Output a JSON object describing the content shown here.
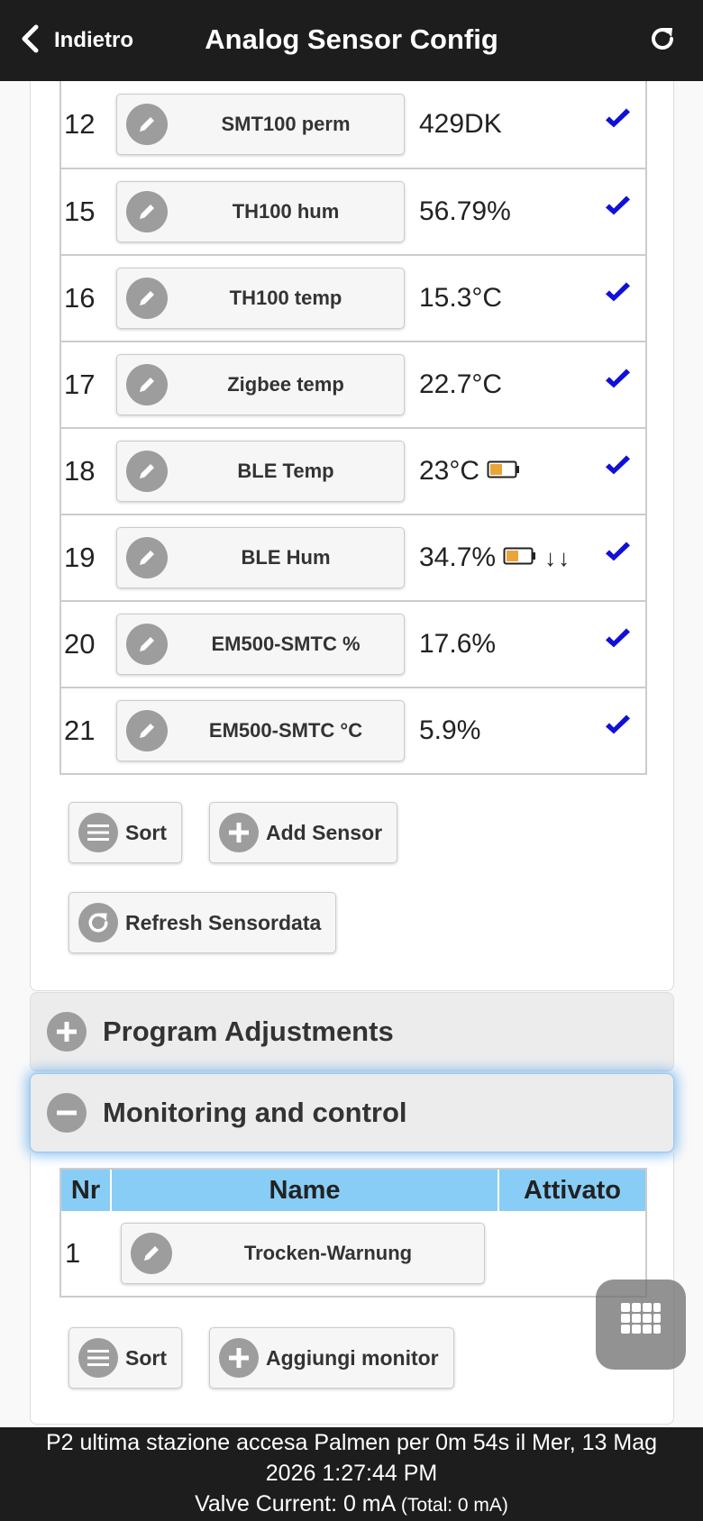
{
  "header": {
    "back_label": "Indietro",
    "title": "Analog Sensor Config"
  },
  "sensors": [
    {
      "nr": "12",
      "name": "SMT100 perm",
      "value": "429DK",
      "battery": false,
      "arrows": ""
    },
    {
      "nr": "15",
      "name": "TH100 hum",
      "value": "56.79%",
      "battery": false,
      "arrows": ""
    },
    {
      "nr": "16",
      "name": "TH100 temp",
      "value": "15.3°C",
      "battery": false,
      "arrows": ""
    },
    {
      "nr": "17",
      "name": "Zigbee temp",
      "value": "22.7°C",
      "battery": false,
      "arrows": ""
    },
    {
      "nr": "18",
      "name": "BLE Temp",
      "value": "23°C",
      "battery": true,
      "arrows": ""
    },
    {
      "nr": "19",
      "name": "BLE Hum",
      "value": "34.7%",
      "battery": true,
      "arrows": "↓↓"
    },
    {
      "nr": "20",
      "name": "EM500-SMTC %",
      "value": "17.6%",
      "battery": false,
      "arrows": ""
    },
    {
      "nr": "21",
      "name": "EM500-SMTC °C",
      "value": "5.9%",
      "battery": false,
      "arrows": ""
    }
  ],
  "buttons": {
    "sort": "Sort",
    "add_sensor": "Add Sensor",
    "refresh_sensordata": "Refresh Sensordata",
    "sort2": "Sort",
    "add_monitor": "Aggiungi monitor"
  },
  "sections": {
    "program_adjustments": "Program Adjustments",
    "monitoring": "Monitoring and control"
  },
  "monitor_table": {
    "headers": [
      "Nr",
      "Name",
      "Attivato"
    ],
    "rows": [
      {
        "nr": "1",
        "name": "Trocken-Warnung"
      }
    ]
  },
  "footer": {
    "line1": "P2 ultima stazione accesa Palmen per 0m 54s il Mer, 13 Mag",
    "line2": "2026 1:27:44 PM",
    "line3": "Valve Current: 0 mA",
    "line3_total": "(Total: 0 mA)"
  },
  "colors": {
    "header_bg": "#1d1d1d",
    "check": "#1010d8",
    "table_head": "#88cdf6",
    "battery_fill": "#e8a53a"
  }
}
